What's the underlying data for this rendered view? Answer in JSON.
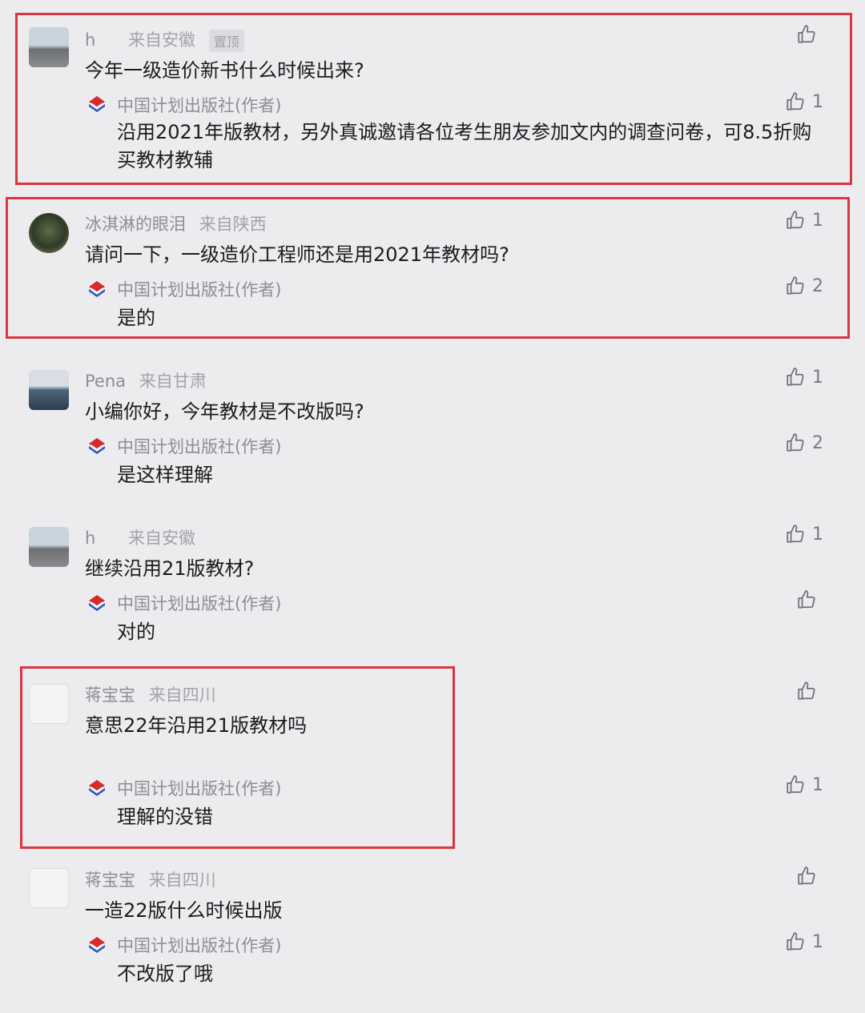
{
  "comments": [
    {
      "name": "h",
      "location": "来自安徽",
      "pinned": "置顶",
      "text": "今年一级造价新书什么时候出来?",
      "likes": "",
      "reply": {
        "author": "中国计划出版社(作者)",
        "text": "沿用2021年版教材，另外真诚邀请各位考生朋友参加文内的调查问卷，可8.5折购买教材教辅",
        "likes": "1"
      }
    },
    {
      "name": "冰淇淋的眼泪",
      "location": "来自陕西",
      "text": "请问一下，一级造价工程师还是用2021年教材吗?",
      "likes": "1",
      "reply": {
        "author": "中国计划出版社(作者)",
        "text": "是的",
        "likes": "2"
      }
    },
    {
      "name": "Pena",
      "location": "来自甘肃",
      "text": "小编你好，今年教材是不改版吗?",
      "likes": "1",
      "reply": {
        "author": "中国计划出版社(作者)",
        "text": "是这样理解",
        "likes": "2"
      }
    },
    {
      "name": "h",
      "location": "来自安徽",
      "text": "继续沿用21版教材?",
      "likes": "1",
      "reply": {
        "author": "中国计划出版社(作者)",
        "text": "对的",
        "likes": ""
      }
    },
    {
      "name": "蒋宝宝",
      "location": "来自四川",
      "text": "意思22年沿用21版教材吗",
      "likes": "",
      "reply": {
        "author": "中国计划出版社(作者)",
        "text": "理解的没错",
        "likes": "1"
      }
    },
    {
      "name": "蒋宝宝",
      "location": "来自四川",
      "text": "一造22版什么时候出版",
      "likes": "",
      "reply": {
        "author": "中国计划出版社(作者)",
        "text": "不改版了哦",
        "likes": "1"
      }
    }
  ],
  "colors": {
    "highlight": "#d9363e",
    "background": "#ececef"
  },
  "icons": {
    "like": "thumbs-up-icon",
    "publisher": "publisher-logo-icon"
  }
}
